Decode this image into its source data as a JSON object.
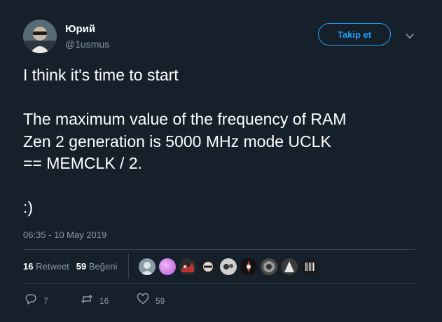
{
  "user": {
    "display_name": "Юрий",
    "handle": "@1usmus"
  },
  "follow_button": {
    "label": "Takip et"
  },
  "tweet": {
    "lines": [
      "I think it's time to start",
      "The maximum value of the frequency of RAM",
      "Zen 2 generation is 5000 MHz mode UCLK",
      "== MEMCLK / 2.",
      ":)"
    ],
    "timestamp": "06:35 - 10 May 2019"
  },
  "stats": {
    "retweets": {
      "count": "16",
      "label": "Retweet"
    },
    "likes": {
      "count": "59",
      "label": "Beğeni"
    }
  },
  "actions": {
    "reply_count": "7",
    "retweet_count": "16",
    "like_count": "59"
  },
  "colors": {
    "background": "#15202b",
    "accent": "#1da1f2",
    "muted": "#8899a6",
    "divider": "#38444d"
  },
  "icons": [
    "caret-down-icon",
    "reply-icon",
    "retweet-icon",
    "heart-icon"
  ]
}
